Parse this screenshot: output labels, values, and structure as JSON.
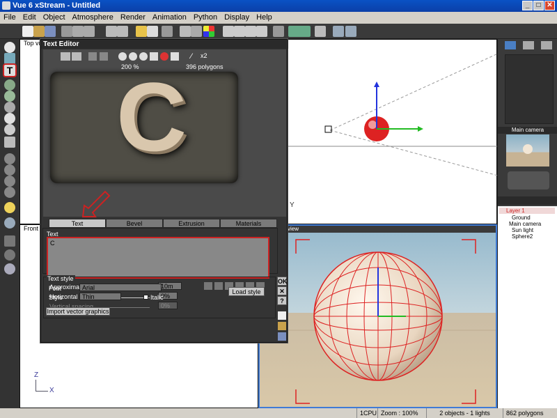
{
  "window": {
    "title": "Vue 6 xStream - Untitled",
    "min": "_",
    "max": "□",
    "close": "✕"
  },
  "menu": [
    "File",
    "Edit",
    "Object",
    "Atmosphere",
    "Render",
    "Animation",
    "Python",
    "Display",
    "Help"
  ],
  "viewports": {
    "top_label": "Top view",
    "front_label": "Front vi",
    "main_label": "view",
    "axis_x": "X",
    "axis_y": "Y",
    "axis_z": "Z"
  },
  "text_editor": {
    "title": "Text Editor",
    "zoom": "200 %",
    "polygons": "396 polygons",
    "x2": "x2",
    "preview_letter": "C",
    "tabs": [
      "Text",
      "Bevel",
      "Extrusion",
      "Materials"
    ],
    "text_section": "Text",
    "text_value": "C",
    "size_label": "Approximate size of characters in Vue units",
    "size_value": "10m",
    "hspacing_label": "Horizontal spacing",
    "hspacing_value": "0%",
    "vspacing_label": "Vertical spacing",
    "vspacing_value": "0%",
    "style_section": "Text style",
    "font_label": "Font",
    "font_value": "Arial",
    "style_label": "Style",
    "style_value": "Thin",
    "italic_label": "Italic",
    "load_style": "Load style",
    "import_vector": "Import vector graphics",
    "ok": "OK",
    "cancel": "✕",
    "help": "?"
  },
  "right_panel": {
    "camera_title": "Main camera",
    "layers": [
      "Layer 1",
      "Ground",
      "Main camera",
      "Sun light",
      "Sphere2"
    ]
  },
  "status": {
    "cpu": "1CPU",
    "zoom": "Zoom : 100%",
    "objects": "2 objects - 1 lights",
    "polygons": "862 polygons"
  },
  "colors": {
    "accent_red": "#cc2222",
    "selection_blue": "#0a52c4"
  }
}
